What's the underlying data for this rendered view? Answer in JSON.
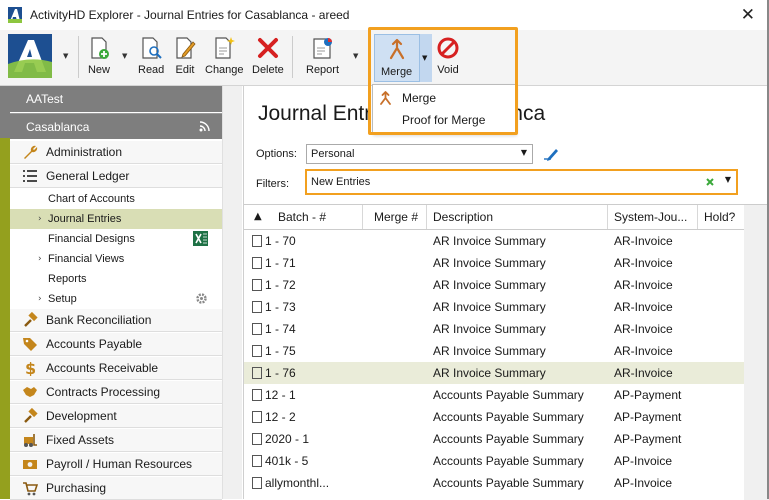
{
  "window": {
    "title": "ActivityHD Explorer - Journal Entries for Casablanca - areed",
    "close_glyph": "✕"
  },
  "toolbar": {
    "new_label": "New",
    "read_label": "Read",
    "edit_label": "Edit",
    "change_label": "Change",
    "delete_label": "Delete",
    "report_label": "Report",
    "merge_label": "Merge",
    "void_label": "Void"
  },
  "merge_menu": {
    "items": [
      "Merge",
      "Proof for Merge"
    ]
  },
  "sidebar": {
    "company_group": "AATest",
    "company": "Casablanca",
    "items": [
      {
        "label": "Administration",
        "icon": "wrench-icon"
      },
      {
        "label": "General Ledger",
        "icon": "list-icon"
      }
    ],
    "gl_sub": [
      {
        "label": "Chart of Accounts",
        "chevron": ""
      },
      {
        "label": "Journal Entries",
        "chevron": "›"
      },
      {
        "label": "Financial Designs",
        "chevron": ""
      },
      {
        "label": "Financial Views",
        "chevron": "›"
      },
      {
        "label": "Reports",
        "chevron": ""
      },
      {
        "label": "Setup",
        "chevron": "›"
      }
    ],
    "modules": [
      {
        "label": "Bank Reconciliation",
        "icon": "hammer-icon"
      },
      {
        "label": "Accounts Payable",
        "icon": "tag-icon"
      },
      {
        "label": "Accounts Receivable",
        "icon": "dollar-icon"
      },
      {
        "label": "Contracts Processing",
        "icon": "handshake-icon"
      },
      {
        "label": "Development",
        "icon": "hammer-icon"
      },
      {
        "label": "Fixed Assets",
        "icon": "forklift-icon"
      },
      {
        "label": "Payroll / Human Resources",
        "icon": "money-icon"
      },
      {
        "label": "Purchasing",
        "icon": "cart-icon"
      }
    ]
  },
  "main": {
    "title": "Journal Entries for Casablanca",
    "options_label": "Options:",
    "options_value": "Personal",
    "filters_label": "Filters:",
    "filters_value": "New Entries"
  },
  "grid": {
    "columns": [
      "Batch - #",
      "Merge #",
      "Description",
      "System-Jou...",
      "Hold?"
    ],
    "rows": [
      {
        "batch": "1 - 70",
        "merge": "",
        "desc": "AR Invoice Summary",
        "sys": "AR-Invoice",
        "hold": ""
      },
      {
        "batch": "1 - 71",
        "merge": "",
        "desc": "AR Invoice Summary",
        "sys": "AR-Invoice",
        "hold": ""
      },
      {
        "batch": "1 - 72",
        "merge": "",
        "desc": "AR Invoice Summary",
        "sys": "AR-Invoice",
        "hold": ""
      },
      {
        "batch": "1 - 73",
        "merge": "",
        "desc": "AR Invoice Summary",
        "sys": "AR-Invoice",
        "hold": ""
      },
      {
        "batch": "1 - 74",
        "merge": "",
        "desc": "AR Invoice Summary",
        "sys": "AR-Invoice",
        "hold": ""
      },
      {
        "batch": "1 - 75",
        "merge": "",
        "desc": "AR Invoice Summary",
        "sys": "AR-Invoice",
        "hold": ""
      },
      {
        "batch": "1 - 76",
        "merge": "",
        "desc": "AR Invoice Summary",
        "sys": "AR-Invoice",
        "hold": ""
      },
      {
        "batch": "12 - 1",
        "merge": "",
        "desc": "Accounts Payable Summary",
        "sys": "AP-Payment",
        "hold": ""
      },
      {
        "batch": "12 - 2",
        "merge": "",
        "desc": "Accounts Payable Summary",
        "sys": "AP-Payment",
        "hold": ""
      },
      {
        "batch": "2020 - 1",
        "merge": "",
        "desc": "Accounts Payable Summary",
        "sys": "AP-Payment",
        "hold": ""
      },
      {
        "batch": "401k - 5",
        "merge": "",
        "desc": "Accounts Payable Summary",
        "sys": "AP-Invoice",
        "hold": ""
      },
      {
        "batch": "allymonthl...",
        "merge": "",
        "desc": "Accounts Payable Summary",
        "sys": "AP-Invoice",
        "hold": ""
      }
    ]
  },
  "colors": {
    "accent": "#f2a01f",
    "olive": "#94a01e",
    "sidebar_header": "#7e7e7e",
    "selected_row": "#eaecd9"
  }
}
